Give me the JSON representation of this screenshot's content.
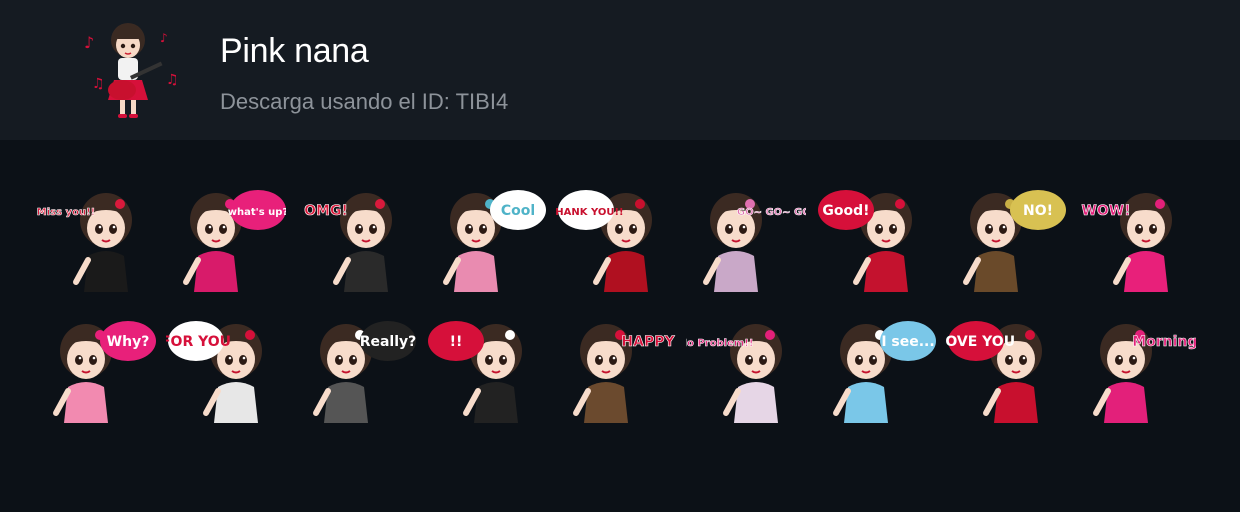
{
  "header": {
    "title": "Pink nana",
    "download_label": "Descarga usando el ID: TIBI4"
  },
  "stickers": [
    {
      "text": "Miss you!!",
      "accent": "#d91a3c",
      "bubble": "none",
      "outfit": "#1a1a1a"
    },
    {
      "text": "what's up?",
      "accent": "#e8207a",
      "bubble": "#e8207a",
      "outfit": "#d81b6a"
    },
    {
      "text": "OMG!",
      "accent": "#d91a3c",
      "bubble": "none",
      "outfit": "#2a2a2a"
    },
    {
      "text": "Cool",
      "accent": "#4fb3c8",
      "bubble": "#ffffff",
      "outfit": "#e98bb0"
    },
    {
      "text": "THANK YOU!!",
      "accent": "#c8102e",
      "bubble": "#ffffff",
      "outfit": "#b01020"
    },
    {
      "text": "GO~ GO~ GO~",
      "accent": "#e070b0",
      "bubble": "none",
      "outfit": "#c9a8c8"
    },
    {
      "text": "Good!",
      "accent": "#d6103a",
      "bubble": "#d6103a",
      "outfit": "#c4122e"
    },
    {
      "text": "NO!",
      "accent": "#c9b046",
      "bubble": "#d8c152",
      "outfit": "#6a4a2a"
    },
    {
      "text": "WOW!",
      "accent": "#e3207a",
      "bubble": "none",
      "outfit": "#e8207a"
    },
    {
      "text": "Why?",
      "accent": "#e8207a",
      "bubble": "#e8207a",
      "outfit": "#f28ab0"
    },
    {
      "text": "FOR YOU",
      "accent": "#d6103a",
      "bubble": "#ffffff",
      "outfit": "#e7e7e7"
    },
    {
      "text": "Really?",
      "accent": "#ffffff",
      "bubble": "#222222",
      "outfit": "#555555"
    },
    {
      "text": "!!",
      "accent": "#ffffff",
      "bubble": "#d6103a",
      "outfit": "#222222"
    },
    {
      "text": "HAPPY",
      "accent": "#d6103a",
      "bubble": "none",
      "outfit": "#6b4a2e"
    },
    {
      "text": "No Problem!!",
      "accent": "#e3207a",
      "bubble": "none",
      "outfit": "#e6d6e6"
    },
    {
      "text": "I see...",
      "accent": "#ffffff",
      "bubble": "#7ac7e8",
      "outfit": "#7ac7e8"
    },
    {
      "text": "LOVE YOU",
      "accent": "#d6103a",
      "bubble": "#d6103a",
      "outfit": "#c8102e"
    },
    {
      "text": "Morning!",
      "accent": "#e3207a",
      "bubble": "none",
      "outfit": "#e3207a"
    }
  ]
}
